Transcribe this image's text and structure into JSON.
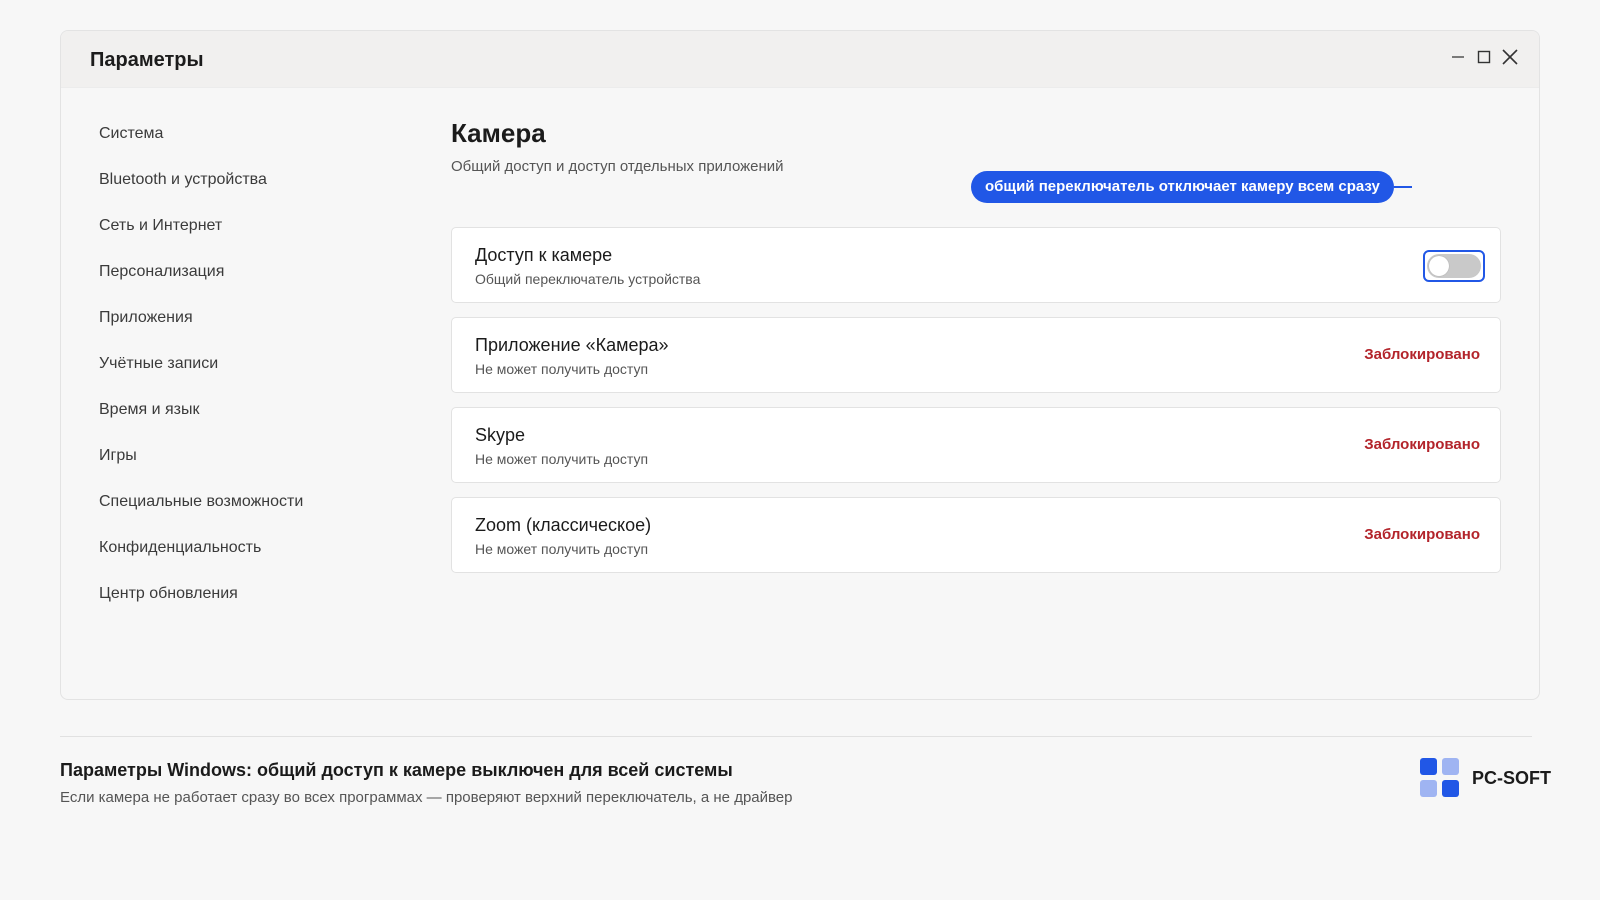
{
  "window": {
    "title": "Параметры"
  },
  "sidebar": {
    "items": [
      {
        "label": "Система"
      },
      {
        "label": "Bluetooth и устройства"
      },
      {
        "label": "Сеть и Интернет"
      },
      {
        "label": "Персонализация"
      },
      {
        "label": "Приложения"
      },
      {
        "label": "Учётные записи"
      },
      {
        "label": "Время и язык"
      },
      {
        "label": "Игры"
      },
      {
        "label": "Специальные возможности"
      },
      {
        "label": "Конфиденциальность"
      },
      {
        "label": "Центр обновления"
      }
    ]
  },
  "main": {
    "title": "Камера",
    "subtitle": "Общий доступ и доступ отдельных приложений",
    "callout": "общий переключатель отключает камеру всем сразу",
    "master": {
      "title": "Доступ к камере",
      "subtitle": "Общий переключатель устройства",
      "toggle_on": false
    },
    "apps": [
      {
        "title": "Приложение «Камера»",
        "subtitle": "Не может получить доступ",
        "status": "Заблокировано"
      },
      {
        "title": "Skype",
        "subtitle": "Не может получить доступ",
        "status": "Заблокировано"
      },
      {
        "title": "Zoom (классическое)",
        "subtitle": "Не может получить доступ",
        "status": "Заблокировано"
      }
    ]
  },
  "footer": {
    "title": "Параметры Windows: общий доступ к камере выключен для всей системы",
    "subtitle": "Если камера не работает сразу во всех программах — проверяют верхний переключатель, а не драйвер"
  },
  "brand": {
    "name": "PC-SOFT"
  },
  "colors": {
    "accent": "#2157e6",
    "blocked": "#b3242b",
    "logo_dark": "#2157e6",
    "logo_light": "#9fb4f2"
  },
  "icons": {
    "minimize": "minimize-icon",
    "maximize": "maximize-icon",
    "close": "close-icon"
  }
}
